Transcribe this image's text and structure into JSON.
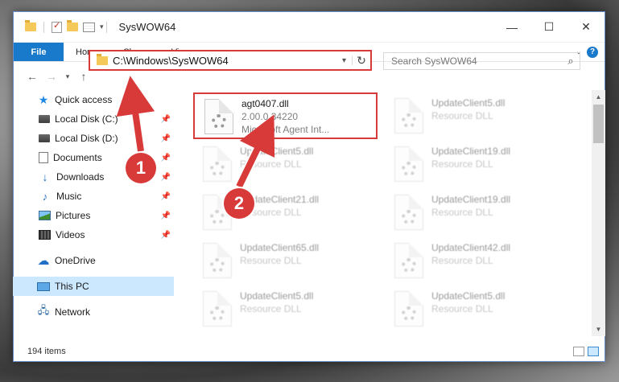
{
  "window": {
    "title": "SysWOW64"
  },
  "ribbon": {
    "file": "File",
    "tabs": [
      "Home",
      "Share",
      "View"
    ]
  },
  "address": {
    "path": "C:\\Windows\\SysWOW64"
  },
  "search": {
    "placeholder": "Search SysWOW64"
  },
  "sidebar": {
    "quick_access": "Quick access",
    "pinned": [
      {
        "label": "Local Disk (C:)",
        "icon": "drive-icon"
      },
      {
        "label": "Local Disk (D:)",
        "icon": "drive-icon"
      },
      {
        "label": "Documents",
        "icon": "documents-icon"
      },
      {
        "label": "Downloads",
        "icon": "downloads-icon"
      },
      {
        "label": "Music",
        "icon": "music-icon"
      },
      {
        "label": "Pictures",
        "icon": "pictures-icon"
      },
      {
        "label": "Videos",
        "icon": "videos-icon"
      }
    ],
    "onedrive": "OneDrive",
    "this_pc": "This PC",
    "network": "Network"
  },
  "files": [
    {
      "name": "agt0407.dll",
      "line2": "2.00.0.34220",
      "line3": "Microsoft Agent Int...",
      "highlighted": true
    },
    {
      "name": "UpdateClient5.dll",
      "line2": "Resource DLL"
    },
    {
      "name": "UpdateClient5.dll",
      "line2": "Resource DLL"
    },
    {
      "name": "UpdateClient19.dll",
      "line2": "Resource DLL"
    },
    {
      "name": "UpdateClient21.dll",
      "line2": "Resource DLL"
    },
    {
      "name": "UpdateClient19.dll",
      "line2": "Resource DLL"
    },
    {
      "name": "UpdateClient65.dll",
      "line2": "Resource DLL"
    },
    {
      "name": "UpdateClient42.dll",
      "line2": "Resource DLL"
    },
    {
      "name": "UpdateClient5.dll",
      "line2": "Resource DLL"
    },
    {
      "name": "UpdateClient5.dll",
      "line2": "Resource DLL"
    }
  ],
  "status": {
    "items": "194 items"
  },
  "annotations": {
    "step1": "1",
    "step2": "2",
    "color": "#d83a3a"
  }
}
